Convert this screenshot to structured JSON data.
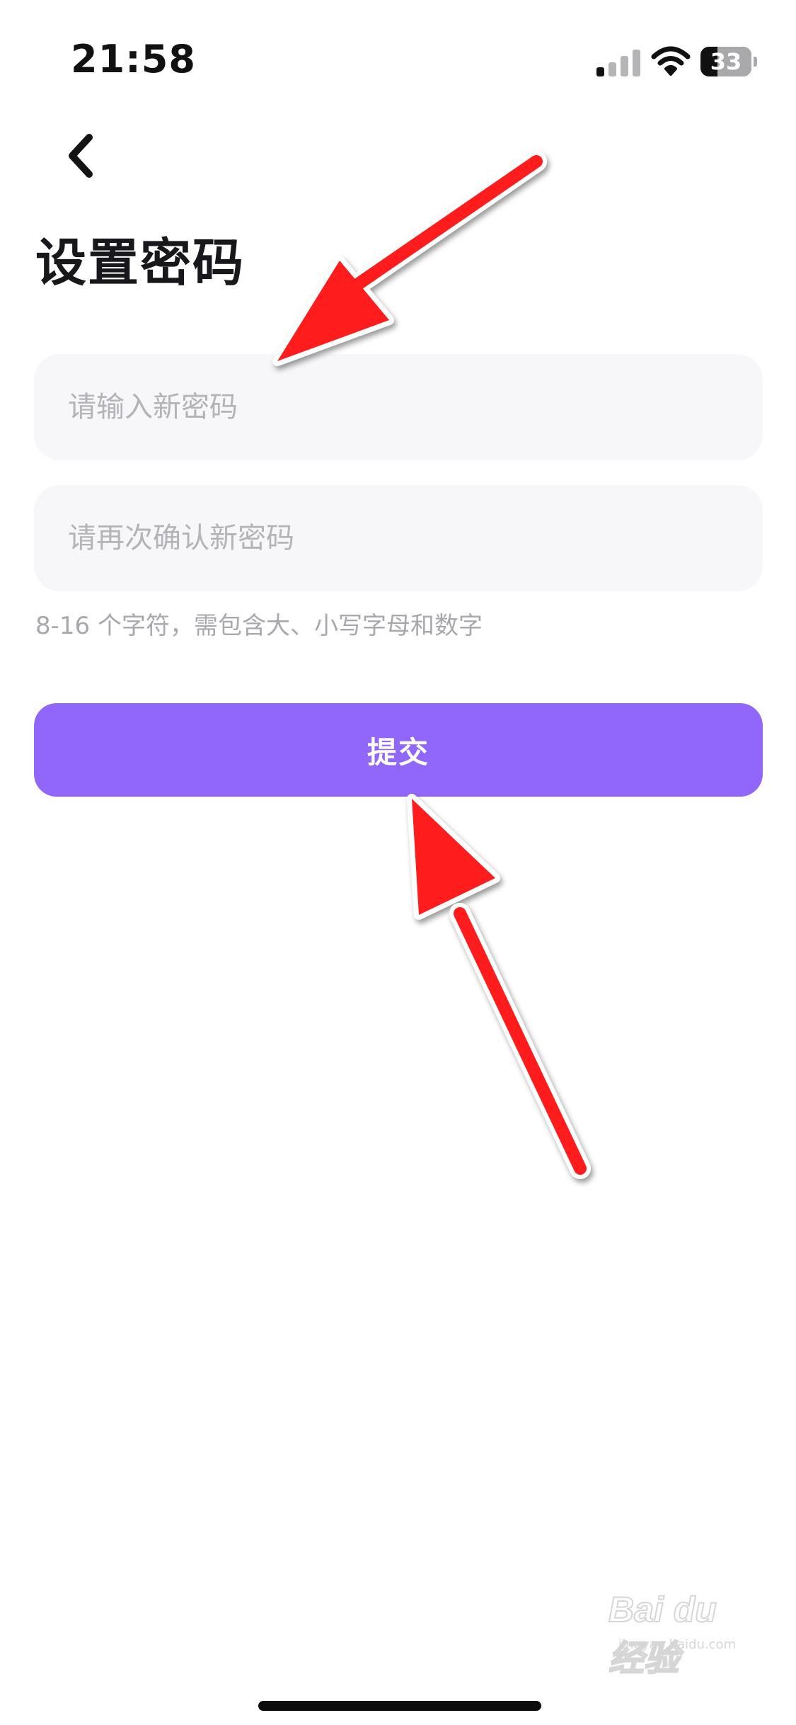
{
  "status_bar": {
    "time": "21:58",
    "battery": "33",
    "battery_level": 0.33,
    "signal_bars_active": 1,
    "signal_bars_total": 4,
    "icons": [
      "cellular-signal-icon",
      "wifi-icon",
      "battery-icon"
    ]
  },
  "nav": {
    "back_icon": "chevron-left-icon"
  },
  "page": {
    "title": "设置密码"
  },
  "form": {
    "new_password": {
      "placeholder": "请输入新密码",
      "value": ""
    },
    "confirm_password": {
      "placeholder": "请再次确认新密码",
      "value": ""
    },
    "hint": "8-16 个字符，需包含大、小写字母和数字",
    "submit_label": "提交"
  },
  "watermark": {
    "brand": "Bai du 经验",
    "url": "jingyan.baidu.com"
  },
  "colors": {
    "accent": "#9166fa",
    "input_bg": "#f7f7f9",
    "placeholder": "#b3b3b8",
    "hint": "#a8a8ad",
    "title": "#17171c",
    "annotation_arrow": "#ff1a1a"
  }
}
